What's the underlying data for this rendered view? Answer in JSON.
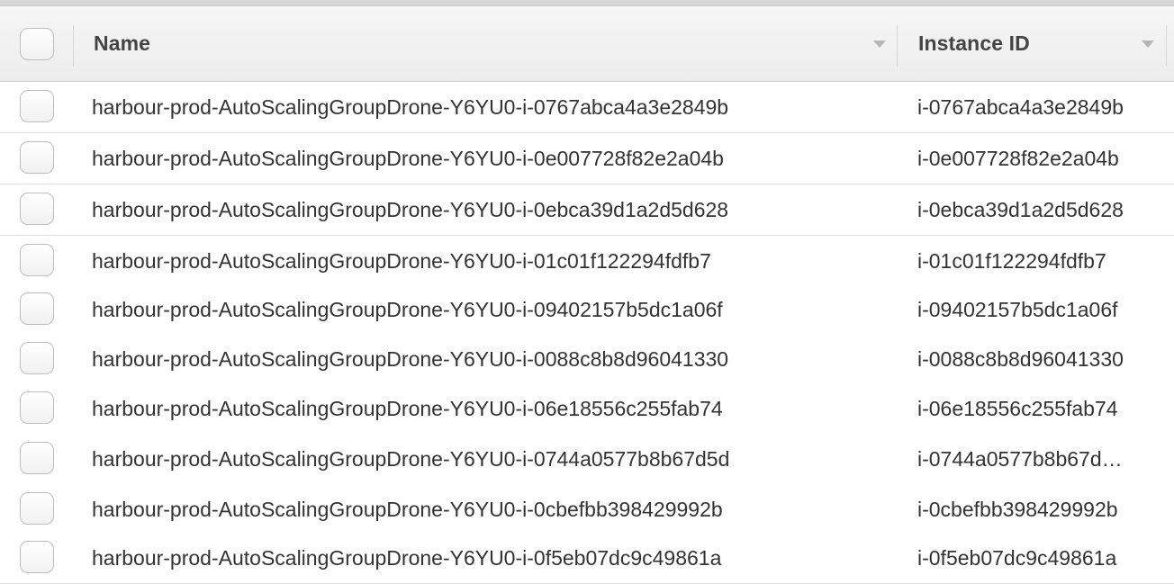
{
  "table": {
    "columns": [
      {
        "label": "Name",
        "sort_icon": "sort-caret-icon"
      },
      {
        "label": "Instance ID",
        "sort_icon": "sort-caret-icon"
      }
    ],
    "rows": [
      {
        "name": "harbour-prod-AutoScalingGroupDrone-Y6YU0-i-0767abca4a3e2849b",
        "instance_id": "i-0767abca4a3e2849b"
      },
      {
        "name": "harbour-prod-AutoScalingGroupDrone-Y6YU0-i-0e007728f82e2a04b",
        "instance_id": "i-0e007728f82e2a04b"
      },
      {
        "name": "harbour-prod-AutoScalingGroupDrone-Y6YU0-i-0ebca39d1a2d5d628",
        "instance_id": "i-0ebca39d1a2d5d628"
      },
      {
        "name": "harbour-prod-AutoScalingGroupDrone-Y6YU0-i-01c01f122294fdfb7",
        "instance_id": "i-01c01f122294fdfb7"
      },
      {
        "name": "harbour-prod-AutoScalingGroupDrone-Y6YU0-i-09402157b5dc1a06f",
        "instance_id": "i-09402157b5dc1a06f"
      },
      {
        "name": "harbour-prod-AutoScalingGroupDrone-Y6YU0-i-0088c8b8d96041330",
        "instance_id": "i-0088c8b8d96041330"
      },
      {
        "name": "harbour-prod-AutoScalingGroupDrone-Y6YU0-i-06e18556c255fab74",
        "instance_id": "i-06e18556c255fab74"
      },
      {
        "name": "harbour-prod-AutoScalingGroupDrone-Y6YU0-i-0744a0577b8b67d5d",
        "instance_id": "i-0744a0577b8b67d…"
      },
      {
        "name": "harbour-prod-AutoScalingGroupDrone-Y6YU0-i-0cbefbb398429992b",
        "instance_id": "i-0cbefbb398429992b"
      },
      {
        "name": "harbour-prod-AutoScalingGroupDrone-Y6YU0-i-0f5eb07dc9c49861a",
        "instance_id": "i-0f5eb07dc9c49861a"
      }
    ],
    "colors": {
      "header_bg": "#f0f0f0",
      "row_border": "#dfdfdf",
      "text": "#333333",
      "header_text": "#444444"
    }
  }
}
